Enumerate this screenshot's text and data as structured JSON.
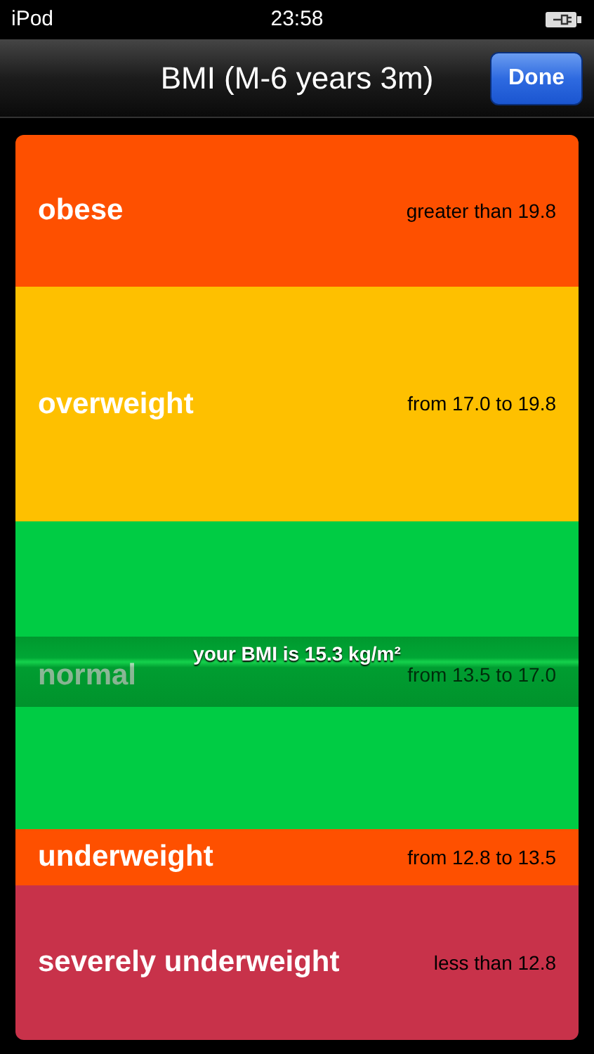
{
  "status_bar": {
    "carrier": "iPod",
    "time": "23:58"
  },
  "nav_bar": {
    "title": "BMI (M-6 years 3m)",
    "done_button": "Done"
  },
  "bands": [
    {
      "label": "obese",
      "range": "greater than 19.8",
      "color": "#fe5000"
    },
    {
      "label": "overweight",
      "range": "from 17.0 to 19.8",
      "color": "#fec000"
    },
    {
      "label": "normal",
      "range": "from 13.5 to 17.0",
      "color": "#00cc44",
      "marker": "your BMI is 15.3 kg/m²"
    },
    {
      "label": "underweight",
      "range": "from 12.8 to 13.5",
      "color": "#fe5000"
    },
    {
      "label": "severely underweight",
      "range": "less than 12.8",
      "color": "#c8324a"
    }
  ]
}
